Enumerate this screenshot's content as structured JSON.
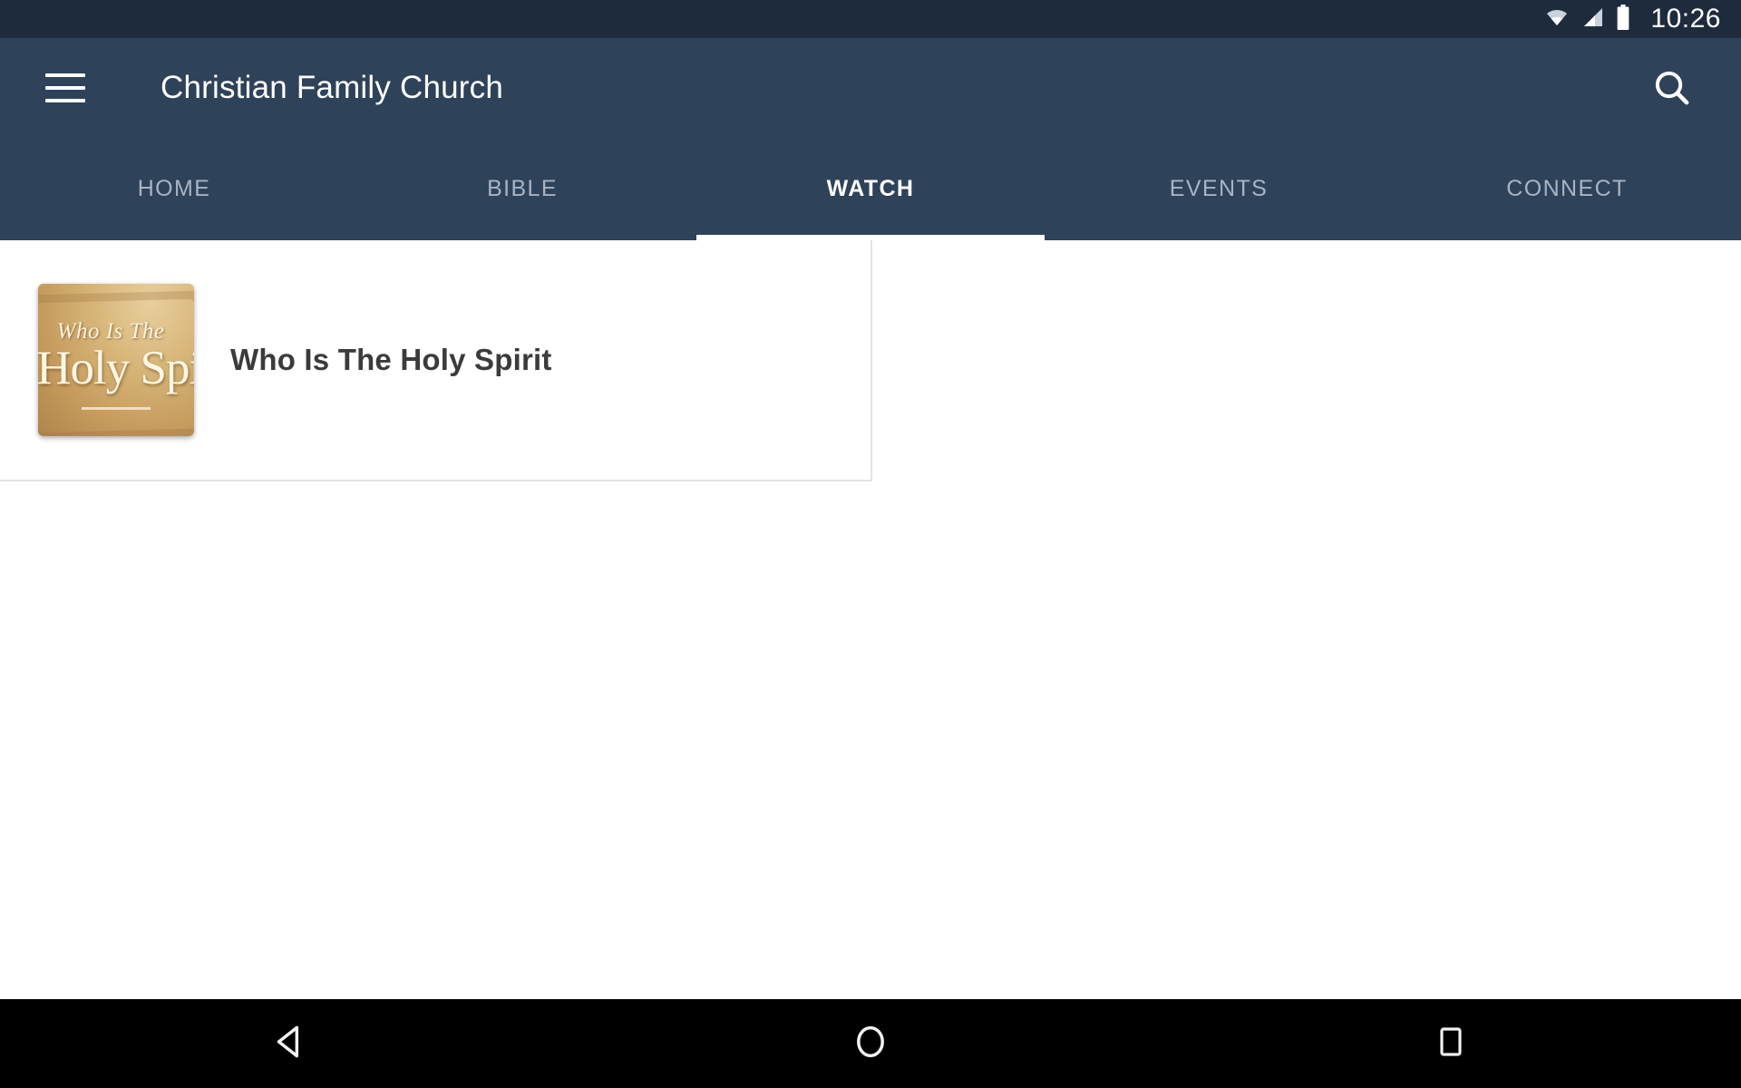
{
  "status_bar": {
    "time": "10:26",
    "icons": [
      "wifi-icon",
      "cellular-signal-icon",
      "battery-icon"
    ]
  },
  "app_bar": {
    "menu_icon": "hamburger-menu-icon",
    "title": "Christian Family Church",
    "search_icon": "search-icon"
  },
  "tabs": [
    {
      "label": "HOME",
      "active": false
    },
    {
      "label": "BIBLE",
      "active": false
    },
    {
      "label": "WATCH",
      "active": true
    },
    {
      "label": "EVENTS",
      "active": false
    },
    {
      "label": "CONNECT",
      "active": false
    }
  ],
  "content": {
    "items": [
      {
        "title": "Who Is The Holy Spirit",
        "thumbnail": {
          "line1": "Who Is The",
          "line2": "Holy Spirit",
          "colors": {
            "highlight": "#e8cf9e",
            "mid": "#c59a5c",
            "shadow": "#b0854b",
            "text": "#fdf6e4"
          }
        }
      }
    ]
  },
  "nav_bar": {
    "buttons": [
      {
        "name": "back-button",
        "icon": "triangle-back-icon"
      },
      {
        "name": "home-button",
        "icon": "circle-home-icon"
      },
      {
        "name": "recents-button",
        "icon": "square-recents-icon"
      }
    ]
  },
  "colors": {
    "status_bar_bg": "#1e2b3d",
    "app_bar_bg": "#2e4259",
    "tab_inactive": "#a8b4c4",
    "tab_active": "#ffffff",
    "content_bg": "#ffffff",
    "title_text": "#3b3b3b",
    "nav_bar_bg": "#000000"
  }
}
